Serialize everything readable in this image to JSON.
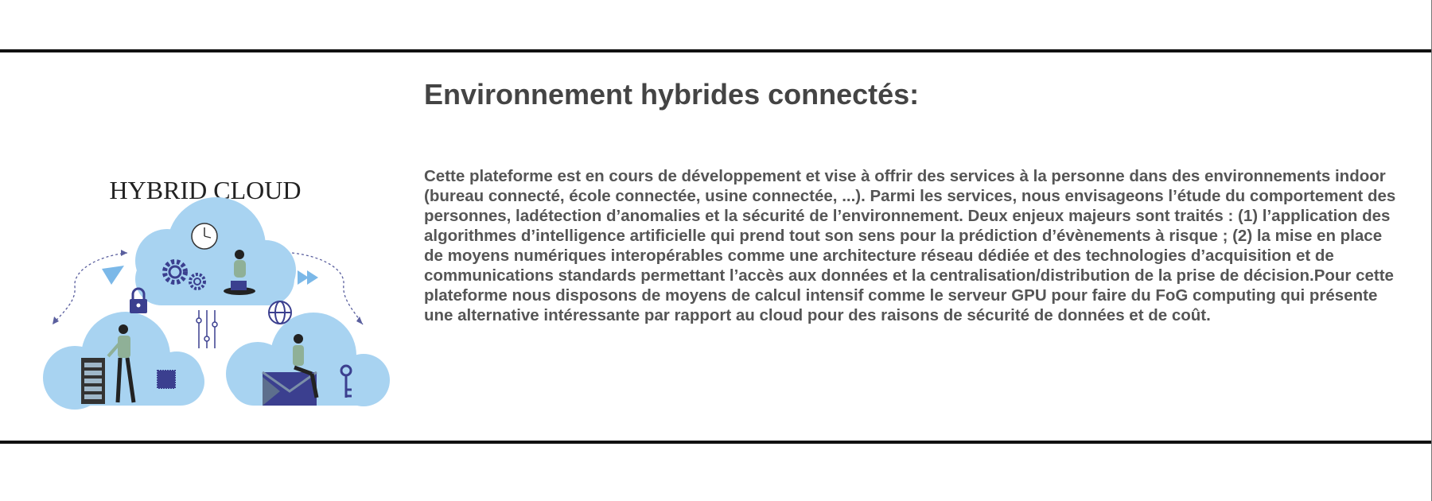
{
  "illustration": {
    "heading": "HYBRID CLOUD",
    "colors": {
      "cloud": "#a8d3f1",
      "accent": "#3b3f8f",
      "figure_shirt": "#8fb097",
      "figure_pants": "#222222"
    }
  },
  "section": {
    "title": "Environnement hybrides connectés:",
    "body": "Cette plateforme est en cours de développement et vise à offrir des services à la personne dans des environnements indoor (bureau connecté, école connectée, usine connectée, ...). Parmi les services, nous envisageons l’étude du comportement des personnes, ladétection d’anomalies et la sécurité de l’environnement. Deux enjeux majeurs sont traités : (1) l’application des algorithmes d’intelligence artificielle qui prend tout son sens pour la prédiction d’évènements à risque ; (2) la mise en place de moyens numériques interopérables comme une architecture réseau dédiée et des technologies d’acquisition et de communications standards permettant l’accès aux données et la centralisation/distribution de la prise de décision.Pour cette plateforme nous disposons de moyens de calcul intensif comme le serveur GPU pour faire du FoG computing qui présente une alternative intéressante par rapport au cloud pour des raisons de sécurité de données et de coût."
  }
}
